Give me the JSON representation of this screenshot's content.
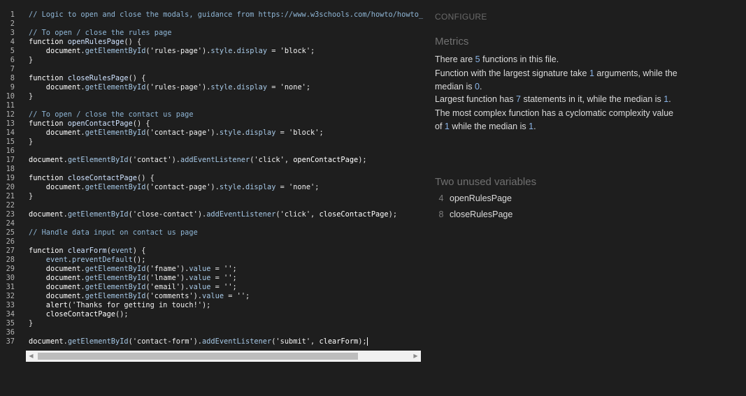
{
  "editor": {
    "lines": [
      {
        "n": "1",
        "segs": [
          [
            "cmt",
            "// Logic to open and close the modals, guidance from https://www.w3schools.com/howto/howto_"
          ]
        ]
      },
      {
        "n": "2",
        "segs": []
      },
      {
        "n": "3",
        "segs": [
          [
            "cmt",
            "// To open / close the rules page"
          ]
        ]
      },
      {
        "n": "4",
        "segs": [
          [
            "kw",
            "function "
          ],
          [
            "fn",
            "openRulesPage"
          ],
          [
            "p",
            "() {"
          ]
        ]
      },
      {
        "n": "5",
        "segs": [
          [
            "id",
            "    document"
          ],
          [
            "p",
            "."
          ],
          [
            "prop",
            "getElementById"
          ],
          [
            "p",
            "("
          ],
          [
            "str",
            "'rules-page'"
          ],
          [
            "p",
            ")."
          ],
          [
            "prop",
            "style"
          ],
          [
            "p",
            "."
          ],
          [
            "prop",
            "display"
          ],
          [
            "p",
            " = "
          ],
          [
            "str",
            "'block'"
          ],
          [
            "p",
            ";"
          ]
        ]
      },
      {
        "n": "6",
        "segs": [
          [
            "p",
            "}"
          ]
        ]
      },
      {
        "n": "7",
        "segs": []
      },
      {
        "n": "8",
        "segs": [
          [
            "kw",
            "function "
          ],
          [
            "fn",
            "closeRulesPage"
          ],
          [
            "p",
            "() {"
          ]
        ]
      },
      {
        "n": "9",
        "segs": [
          [
            "id",
            "    document"
          ],
          [
            "p",
            "."
          ],
          [
            "prop",
            "getElementById"
          ],
          [
            "p",
            "("
          ],
          [
            "str",
            "'rules-page'"
          ],
          [
            "p",
            ")."
          ],
          [
            "prop",
            "style"
          ],
          [
            "p",
            "."
          ],
          [
            "prop",
            "display"
          ],
          [
            "p",
            " = "
          ],
          [
            "str",
            "'none'"
          ],
          [
            "p",
            ";"
          ]
        ]
      },
      {
        "n": "10",
        "segs": [
          [
            "p",
            "}"
          ]
        ]
      },
      {
        "n": "11",
        "segs": []
      },
      {
        "n": "12",
        "segs": [
          [
            "cmt",
            "// To open / close the contact us page"
          ]
        ]
      },
      {
        "n": "13",
        "segs": [
          [
            "kw",
            "function "
          ],
          [
            "fn",
            "openContactPage"
          ],
          [
            "p",
            "() {"
          ]
        ]
      },
      {
        "n": "14",
        "segs": [
          [
            "id",
            "    document"
          ],
          [
            "p",
            "."
          ],
          [
            "prop",
            "getElementById"
          ],
          [
            "p",
            "("
          ],
          [
            "str",
            "'contact-page'"
          ],
          [
            "p",
            ")."
          ],
          [
            "prop",
            "style"
          ],
          [
            "p",
            "."
          ],
          [
            "prop",
            "display"
          ],
          [
            "p",
            " = "
          ],
          [
            "str",
            "'block'"
          ],
          [
            "p",
            ";"
          ]
        ]
      },
      {
        "n": "15",
        "segs": [
          [
            "p",
            "}"
          ]
        ]
      },
      {
        "n": "16",
        "segs": []
      },
      {
        "n": "17",
        "segs": [
          [
            "id",
            "document"
          ],
          [
            "p",
            "."
          ],
          [
            "prop",
            "getElementById"
          ],
          [
            "p",
            "("
          ],
          [
            "str",
            "'contact'"
          ],
          [
            "p",
            ")."
          ],
          [
            "prop",
            "addEventListener"
          ],
          [
            "p",
            "("
          ],
          [
            "str",
            "'click'"
          ],
          [
            "p",
            ", "
          ],
          [
            "id",
            "openContactPage"
          ],
          [
            "p",
            ");"
          ]
        ]
      },
      {
        "n": "18",
        "segs": []
      },
      {
        "n": "19",
        "segs": [
          [
            "kw",
            "function "
          ],
          [
            "fn",
            "closeContactPage"
          ],
          [
            "p",
            "() {"
          ]
        ]
      },
      {
        "n": "20",
        "segs": [
          [
            "id",
            "    document"
          ],
          [
            "p",
            "."
          ],
          [
            "prop",
            "getElementById"
          ],
          [
            "p",
            "("
          ],
          [
            "str",
            "'contact-page'"
          ],
          [
            "p",
            ")."
          ],
          [
            "prop",
            "style"
          ],
          [
            "p",
            "."
          ],
          [
            "prop",
            "display"
          ],
          [
            "p",
            " = "
          ],
          [
            "str",
            "'none'"
          ],
          [
            "p",
            ";"
          ]
        ]
      },
      {
        "n": "21",
        "segs": [
          [
            "p",
            "}"
          ]
        ]
      },
      {
        "n": "22",
        "segs": []
      },
      {
        "n": "23",
        "segs": [
          [
            "id",
            "document"
          ],
          [
            "p",
            "."
          ],
          [
            "prop",
            "getElementById"
          ],
          [
            "p",
            "("
          ],
          [
            "str",
            "'close-contact'"
          ],
          [
            "p",
            ")."
          ],
          [
            "prop",
            "addEventListener"
          ],
          [
            "p",
            "("
          ],
          [
            "str",
            "'click'"
          ],
          [
            "p",
            ", "
          ],
          [
            "id",
            "closeContactPage"
          ],
          [
            "p",
            ");"
          ]
        ]
      },
      {
        "n": "24",
        "segs": []
      },
      {
        "n": "25",
        "segs": [
          [
            "cmt",
            "// Handle data input on contact us page"
          ]
        ]
      },
      {
        "n": "26",
        "segs": []
      },
      {
        "n": "27",
        "segs": [
          [
            "kw",
            "function "
          ],
          [
            "fn",
            "clearForm"
          ],
          [
            "p",
            "("
          ],
          [
            "prop",
            "event"
          ],
          [
            "p",
            ") {"
          ]
        ]
      },
      {
        "n": "28",
        "segs": [
          [
            "prop",
            "    event"
          ],
          [
            "p",
            "."
          ],
          [
            "prop",
            "preventDefault"
          ],
          [
            "p",
            "();"
          ]
        ]
      },
      {
        "n": "29",
        "segs": [
          [
            "id",
            "    document"
          ],
          [
            "p",
            "."
          ],
          [
            "prop",
            "getElementById"
          ],
          [
            "p",
            "("
          ],
          [
            "str",
            "'fname'"
          ],
          [
            "p",
            ")."
          ],
          [
            "prop",
            "value"
          ],
          [
            "p",
            " = "
          ],
          [
            "str",
            "''"
          ],
          [
            "p",
            ";"
          ]
        ]
      },
      {
        "n": "30",
        "segs": [
          [
            "id",
            "    document"
          ],
          [
            "p",
            "."
          ],
          [
            "prop",
            "getElementById"
          ],
          [
            "p",
            "("
          ],
          [
            "str",
            "'lname'"
          ],
          [
            "p",
            ")."
          ],
          [
            "prop",
            "value"
          ],
          [
            "p",
            " = "
          ],
          [
            "str",
            "''"
          ],
          [
            "p",
            ";"
          ]
        ]
      },
      {
        "n": "31",
        "segs": [
          [
            "id",
            "    document"
          ],
          [
            "p",
            "."
          ],
          [
            "prop",
            "getElementById"
          ],
          [
            "p",
            "("
          ],
          [
            "str",
            "'email'"
          ],
          [
            "p",
            ")."
          ],
          [
            "prop",
            "value"
          ],
          [
            "p",
            " = "
          ],
          [
            "str",
            "''"
          ],
          [
            "p",
            ";"
          ]
        ]
      },
      {
        "n": "32",
        "segs": [
          [
            "id",
            "    document"
          ],
          [
            "p",
            "."
          ],
          [
            "prop",
            "getElementById"
          ],
          [
            "p",
            "("
          ],
          [
            "str",
            "'comments'"
          ],
          [
            "p",
            ")."
          ],
          [
            "prop",
            "value"
          ],
          [
            "p",
            " = "
          ],
          [
            "str",
            "''"
          ],
          [
            "p",
            ";"
          ]
        ]
      },
      {
        "n": "33",
        "segs": [
          [
            "id",
            "    alert"
          ],
          [
            "p",
            "("
          ],
          [
            "str",
            "'Thanks for getting in touch!'"
          ],
          [
            "p",
            ");"
          ]
        ]
      },
      {
        "n": "34",
        "segs": [
          [
            "id",
            "    closeContactPage"
          ],
          [
            "p",
            "();"
          ]
        ]
      },
      {
        "n": "35",
        "segs": [
          [
            "p",
            "}"
          ]
        ]
      },
      {
        "n": "36",
        "segs": []
      },
      {
        "n": "37",
        "segs": [
          [
            "id",
            "document"
          ],
          [
            "p",
            "."
          ],
          [
            "prop",
            "getElementById"
          ],
          [
            "p",
            "("
          ],
          [
            "str",
            "'contact-form'"
          ],
          [
            "p",
            ")."
          ],
          [
            "prop",
            "addEventListener"
          ],
          [
            "p",
            "("
          ],
          [
            "str",
            "'submit'"
          ],
          [
            "p",
            ", "
          ],
          [
            "id",
            "clearForm"
          ],
          [
            "p",
            ");"
          ]
        ],
        "cursor": true
      }
    ],
    "scrollbar": {
      "left_arrow_icon": "◀",
      "right_arrow_icon": "▶"
    }
  },
  "panel": {
    "configure_label": "CONFIGURE",
    "metrics_heading": "Metrics",
    "metrics": {
      "functions_count": "5",
      "largest_signature_args": "1",
      "signature_median": "0",
      "largest_function_statements": "7",
      "statements_median": "1",
      "max_cyclomatic": "1",
      "cyclomatic_median": "1"
    },
    "unused_heading": "Two unused variables",
    "unused": [
      {
        "line": "4",
        "name": "openRulesPage"
      },
      {
        "line": "8",
        "name": "closeRulesPage"
      }
    ]
  },
  "colors": {
    "background": "#1e1e1e",
    "number_accent": "#8ab4e6"
  }
}
